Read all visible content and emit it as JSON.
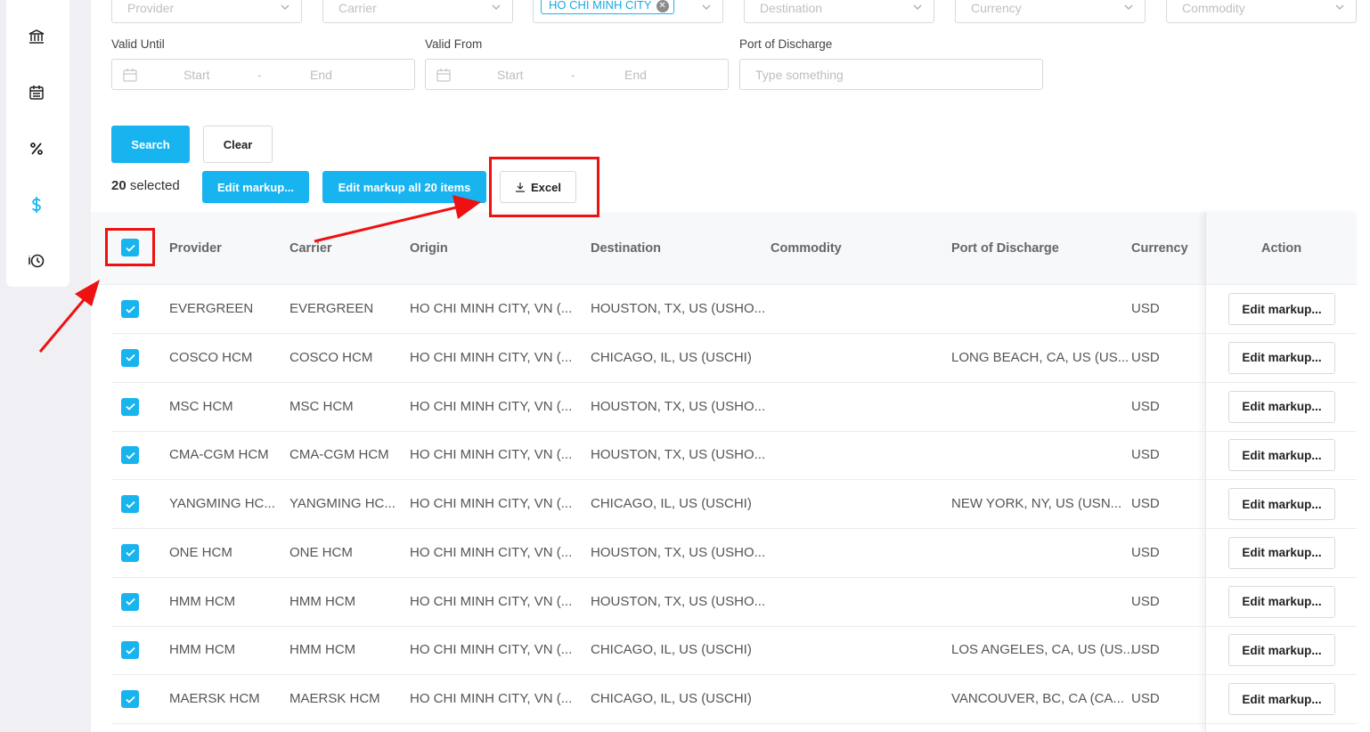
{
  "filters": {
    "provider_placeholder": "Provider",
    "carrier_placeholder": "Carrier",
    "origin_tag": "HO CHI MINH CITY",
    "destination_placeholder": "Destination",
    "currency_placeholder": "Currency",
    "commodity_placeholder": "Commodity",
    "valid_until_label": "Valid Until",
    "valid_from_label": "Valid From",
    "port_of_discharge_label": "Port of Discharge",
    "range_start": "Start",
    "range_end": "End",
    "range_sep": "-",
    "port_placeholder": "Type something"
  },
  "actions": {
    "search": "Search",
    "clear": "Clear",
    "selected_count": "20",
    "selected_word": "selected",
    "edit_markup": "Edit markup...",
    "edit_all": "Edit markup all 20 items",
    "excel": "Excel"
  },
  "table": {
    "headers": {
      "provider": "Provider",
      "carrier": "Carrier",
      "origin": "Origin",
      "destination": "Destination",
      "commodity": "Commodity",
      "port": "Port of Discharge",
      "currency": "Currency",
      "action": "Action"
    },
    "action_label": "Edit markup...",
    "rows": [
      {
        "provider": "EVERGREEN",
        "carrier": "EVERGREEN",
        "origin": "HO CHI MINH CITY, VN (...",
        "destination": "HOUSTON, TX, US (USHO...",
        "commodity": "",
        "port": "",
        "currency": "USD"
      },
      {
        "provider": "COSCO HCM",
        "carrier": "COSCO HCM",
        "origin": "HO CHI MINH CITY, VN (...",
        "destination": "CHICAGO, IL, US (USCHI)",
        "commodity": "",
        "port": "LONG BEACH, CA, US (US...",
        "currency": "USD"
      },
      {
        "provider": "MSC HCM",
        "carrier": "MSC HCM",
        "origin": "HO CHI MINH CITY, VN (...",
        "destination": "HOUSTON, TX, US (USHO...",
        "commodity": "",
        "port": "",
        "currency": "USD"
      },
      {
        "provider": "CMA-CGM HCM",
        "carrier": "CMA-CGM HCM",
        "origin": "HO CHI MINH CITY, VN (...",
        "destination": "HOUSTON, TX, US (USHO...",
        "commodity": "",
        "port": "",
        "currency": "USD"
      },
      {
        "provider": "YANGMING HC...",
        "carrier": "YANGMING HC...",
        "origin": "HO CHI MINH CITY, VN (...",
        "destination": "CHICAGO, IL, US (USCHI)",
        "commodity": "",
        "port": "NEW YORK, NY, US (USN...",
        "currency": "USD"
      },
      {
        "provider": "ONE HCM",
        "carrier": "ONE HCM",
        "origin": "HO CHI MINH CITY, VN (...",
        "destination": "HOUSTON, TX, US (USHO...",
        "commodity": "",
        "port": "",
        "currency": "USD"
      },
      {
        "provider": "HMM HCM",
        "carrier": "HMM HCM",
        "origin": "HO CHI MINH CITY, VN (...",
        "destination": "HOUSTON, TX, US (USHO...",
        "commodity": "",
        "port": "",
        "currency": "USD"
      },
      {
        "provider": "HMM HCM",
        "carrier": "HMM HCM",
        "origin": "HO CHI MINH CITY, VN (...",
        "destination": "CHICAGO, IL, US (USCHI)",
        "commodity": "",
        "port": "LOS ANGELES, CA, US (US...",
        "currency": "USD"
      },
      {
        "provider": "MAERSK HCM",
        "carrier": "MAERSK HCM",
        "origin": "HO CHI MINH CITY, VN (...",
        "destination": "CHICAGO, IL, US (USCHI)",
        "commodity": "",
        "port": "VANCOUVER, BC, CA (CA...",
        "currency": "USD"
      }
    ]
  },
  "sidebar": {
    "icons": [
      "bank-icon",
      "calendar-icon",
      "percent-icon",
      "dollar-icon",
      "history-icon"
    ],
    "active": "dollar-icon"
  },
  "colors": {
    "accent": "#18b4f0",
    "annotation": "#ee1111",
    "background": "#efeff4"
  }
}
